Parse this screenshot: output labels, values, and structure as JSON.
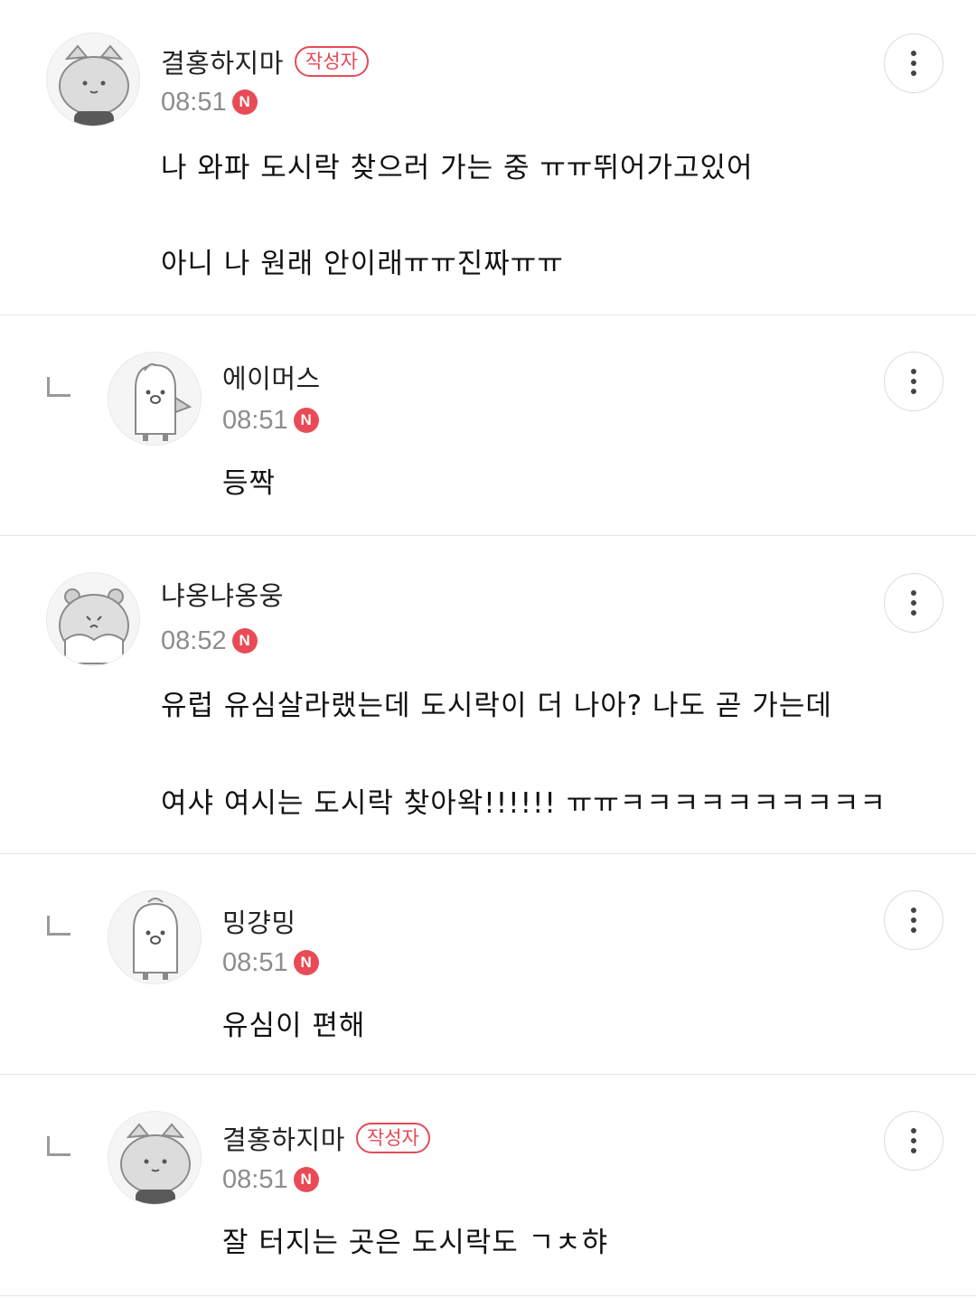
{
  "comments": [
    {
      "author": "결홍하지마",
      "badge": "작성자",
      "time": "08:51",
      "new_badge": "N",
      "lines": [
        "나 와파 도시락 찾으러 가는 중 ㅠㅠ뛰어가고있어",
        "아니 나 원래 안이래ㅠㅠ진짜ㅠㅠ"
      ],
      "is_reply": false,
      "avatar": "cat-avatar-icon"
    },
    {
      "author": "에이머스",
      "time": "08:51",
      "new_badge": "N",
      "lines": [
        "등짝"
      ],
      "is_reply": true,
      "avatar": "penguin-avatar-icon"
    },
    {
      "author": "냐옹냐옹웅",
      "time": "08:52",
      "new_badge": "N",
      "lines": [
        "유럽 유심살라랬는데 도시락이 더 나아? 나도 곧 가는데",
        "여샤 여시는 도시락 찾아왁!!!!!! ㅠㅠㅋㅋㅋㅋㅋㅋㅋㅋㅋㅋ"
      ],
      "is_reply": false,
      "avatar": "hamster-avatar-icon"
    },
    {
      "author": "밍걍밍",
      "time": "08:51",
      "new_badge": "N",
      "lines": [
        "유심이 편해"
      ],
      "is_reply": true,
      "avatar": "penguin-avatar-icon"
    },
    {
      "author": "결홍하지마",
      "badge": "작성자",
      "time": "08:51",
      "new_badge": "N",
      "lines": [
        "잘 터지는 곳은 도시락도 ㄱㅊ햐"
      ],
      "is_reply": true,
      "avatar": "cat-avatar-icon"
    }
  ],
  "colors": {
    "accent_red": "#e94b56",
    "time_gray": "#8c8c8c",
    "divider": "#e6e6e6"
  }
}
